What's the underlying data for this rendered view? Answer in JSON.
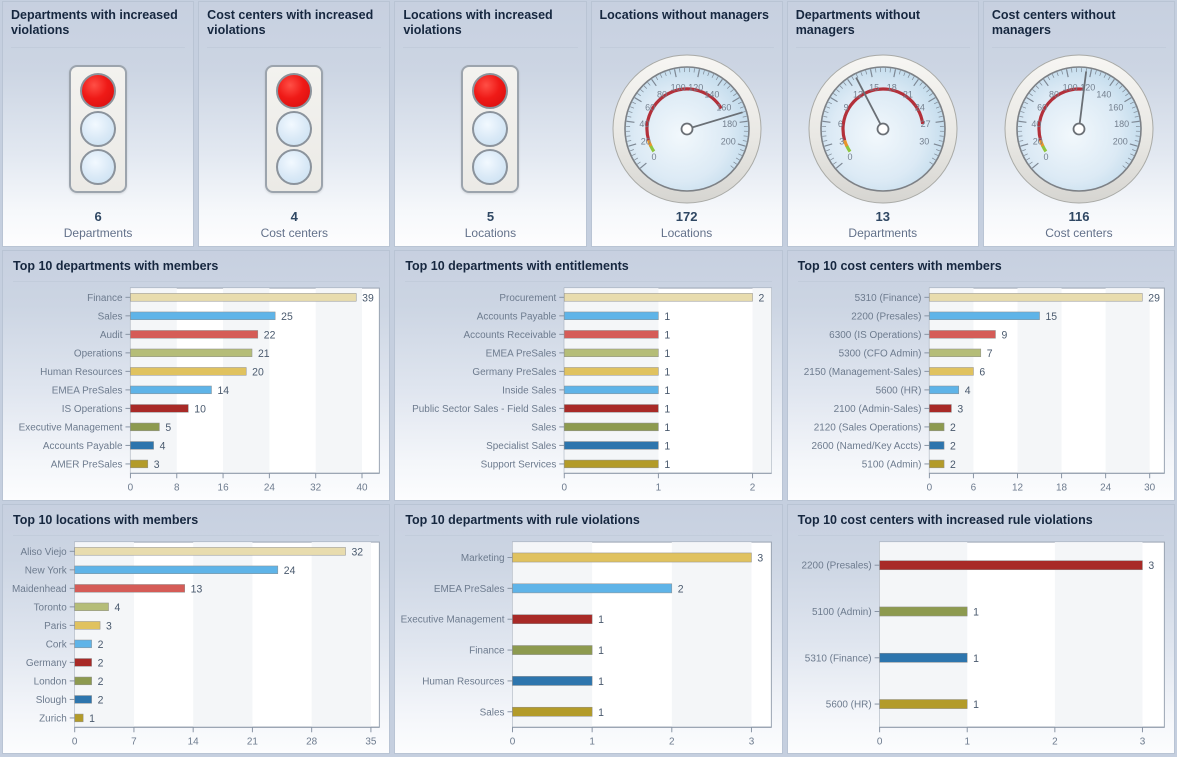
{
  "kpi_panels": [
    {
      "title": "Departments with increased violations",
      "type": "traffic-light",
      "state": "red",
      "value": "6",
      "label": "Departments"
    },
    {
      "title": "Cost centers with increased violations",
      "type": "traffic-light",
      "state": "red",
      "value": "4",
      "label": "Cost centers"
    },
    {
      "title": "Locations with increased violations",
      "type": "traffic-light",
      "state": "red",
      "value": "5",
      "label": "Locations"
    },
    {
      "title": "Locations without managers",
      "type": "gauge",
      "value": "172",
      "label": "Locations",
      "gauge": {
        "min": 0,
        "max": 220,
        "needle": 172,
        "ticks": [
          0,
          20,
          40,
          60,
          80,
          100,
          120,
          140,
          160,
          180,
          200
        ],
        "band_red_from": 20,
        "band_red_to": 160,
        "band_green_from": 5,
        "band_green_to": 20
      }
    },
    {
      "title": "Departments without managers",
      "type": "gauge",
      "value": "13",
      "label": "Departments",
      "gauge": {
        "min": 0,
        "max": 33,
        "needle": 13,
        "ticks": [
          0,
          3,
          6,
          9,
          12,
          15,
          18,
          21,
          24,
          27,
          30
        ],
        "band_red_from": 3,
        "band_red_to": 27,
        "band_green_from": 0.7,
        "band_green_to": 3
      }
    },
    {
      "title": "Cost centers without managers",
      "type": "gauge",
      "value": "116",
      "label": "Cost centers",
      "gauge": {
        "min": 0,
        "max": 220,
        "needle": 116,
        "ticks": [
          0,
          20,
          40,
          60,
          80,
          100,
          120,
          140,
          160,
          180,
          200
        ],
        "band_red_from": 20,
        "band_red_to": 115,
        "band_green_from": 5,
        "band_green_to": 20
      }
    }
  ],
  "palette": [
    "#e8dcae",
    "#5fb4e8",
    "#d55c57",
    "#b5bd78",
    "#e0c25f",
    "#5fb4e8",
    "#a82a27",
    "#8d9a4f",
    "#2d75ad",
    "#b39b29"
  ],
  "chart_data": [
    {
      "type": "bar",
      "orientation": "horizontal",
      "title": "Top 10 departments with members",
      "categories": [
        "Finance",
        "Sales",
        "Audit",
        "Operations",
        "Human Resources",
        "EMEA PreSales",
        "IS Operations",
        "Executive Management",
        "Accounts Payable",
        "AMER PreSales"
      ],
      "values": [
        39,
        25,
        22,
        21,
        20,
        14,
        10,
        5,
        4,
        3
      ],
      "xlabel": "",
      "ylabel": "",
      "xticks": [
        0,
        8,
        16,
        24,
        32,
        40
      ],
      "xlim": [
        0,
        43
      ],
      "grid": true,
      "legend": "none"
    },
    {
      "type": "bar",
      "orientation": "horizontal",
      "title": "Top 10 departments with entitlements",
      "categories": [
        "Procurement",
        "Accounts Payable",
        "Accounts Receivable",
        "EMEA PreSales",
        "Germany PreSales",
        "Inside Sales",
        "Public Sector Sales - Field Sales",
        "Sales",
        "Specialist Sales",
        "Support Services"
      ],
      "values": [
        2,
        1,
        1,
        1,
        1,
        1,
        1,
        1,
        1,
        1
      ],
      "xlabel": "",
      "ylabel": "",
      "xticks": [
        0,
        1,
        2
      ],
      "xlim": [
        0,
        2.2
      ],
      "grid": true,
      "legend": "none"
    },
    {
      "type": "bar",
      "orientation": "horizontal",
      "title": "Top 10 cost centers with members",
      "categories": [
        "5310 (Finance)",
        "2200 (Presales)",
        "6300 (IS Operations)",
        "5300 (CFO Admin)",
        "2150 (Management-Sales)",
        "5600 (HR)",
        "2100 (Admin-Sales)",
        "2120 (Sales Operations)",
        "2600 (Named/Key Accts)",
        "5100 (Admin)"
      ],
      "values": [
        29,
        15,
        9,
        7,
        6,
        4,
        3,
        2,
        2,
        2
      ],
      "xlabel": "",
      "ylabel": "",
      "xticks": [
        0,
        6,
        12,
        18,
        24,
        30
      ],
      "xlim": [
        0,
        32
      ],
      "grid": true,
      "legend": "none"
    },
    {
      "type": "bar",
      "orientation": "horizontal",
      "title": "Top 10 locations with members",
      "categories": [
        "Aliso Viejo",
        "New York",
        "Maidenhead",
        "Toronto",
        "Paris",
        "Cork",
        "Germany",
        "London",
        "Slough",
        "Zurich"
      ],
      "values": [
        32,
        24,
        13,
        4,
        3,
        2,
        2,
        2,
        2,
        1
      ],
      "xlabel": "",
      "ylabel": "",
      "xticks": [
        0,
        7,
        14,
        21,
        28,
        35
      ],
      "xlim": [
        0,
        36
      ],
      "grid": true,
      "legend": "none"
    },
    {
      "type": "bar",
      "orientation": "horizontal",
      "title": "Top 10 departments with rule violations",
      "categories": [
        "Marketing",
        "EMEA PreSales",
        "Executive Management",
        "Finance",
        "Human Resources",
        "Sales"
      ],
      "values": [
        3,
        2,
        1,
        1,
        1,
        1
      ],
      "colors": [
        "#e0c25f",
        "#5fb4e8",
        "#a82a27",
        "#8d9a4f",
        "#2d75ad",
        "#b39b29"
      ],
      "xlabel": "",
      "ylabel": "",
      "xticks": [
        0,
        1,
        2,
        3
      ],
      "xlim": [
        0,
        3.25
      ],
      "grid": true,
      "legend": "none"
    },
    {
      "type": "bar",
      "orientation": "horizontal",
      "title": "Top 10 cost centers with increased rule violations",
      "categories": [
        "2200 (Presales)",
        "5100 (Admin)",
        "5310 (Finance)",
        "5600 (HR)"
      ],
      "values": [
        3,
        1,
        1,
        1
      ],
      "colors": [
        "#a82a27",
        "#8d9a4f",
        "#2d75ad",
        "#b39b29"
      ],
      "xlabel": "",
      "ylabel": "",
      "xticks": [
        0,
        1,
        2,
        3
      ],
      "xlim": [
        0,
        3.25
      ],
      "grid": true,
      "legend": "none"
    }
  ]
}
